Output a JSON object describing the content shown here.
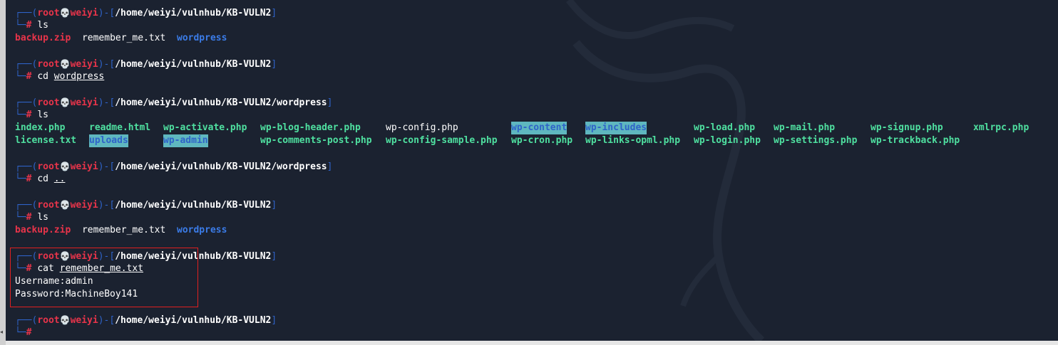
{
  "prompt": {
    "user": "root",
    "host": "weiyi",
    "skull": "💀",
    "open": "┌──(",
    "close": ")-[",
    "end": "]",
    "hash_prefix": "└─",
    "hash": "#"
  },
  "blocks": [
    {
      "path": "/home/weiyi/vulnhub/KB-VULN2",
      "cmd": "ls",
      "cmd_arg": ""
    },
    {
      "path": "/home/weiyi/vulnhub/KB-VULN2",
      "cmd": "cd",
      "cmd_arg": "wordpress"
    },
    {
      "path": "/home/weiyi/vulnhub/KB-VULN2/wordpress",
      "cmd": "ls",
      "cmd_arg": ""
    },
    {
      "path": "/home/weiyi/vulnhub/KB-VULN2/wordpress",
      "cmd": "cd",
      "cmd_arg": ".."
    },
    {
      "path": "/home/weiyi/vulnhub/KB-VULN2",
      "cmd": "ls",
      "cmd_arg": ""
    },
    {
      "path": "/home/weiyi/vulnhub/KB-VULN2",
      "cmd": "cat",
      "cmd_arg": "remember_me.txt"
    },
    {
      "path": "/home/weiyi/vulnhub/KB-VULN2",
      "cmd": "",
      "cmd_arg": ""
    }
  ],
  "ls_kb": {
    "backup": "backup.zip",
    "remember": "remember_me.txt",
    "wordpress": "wordpress"
  },
  "ls_wp": {
    "row1": [
      "index.php",
      "readme.html",
      "wp-activate.php",
      "wp-blog-header.php",
      "wp-config.php",
      "wp-content",
      "wp-includes",
      "wp-load.php",
      "wp-mail.php",
      "wp-signup.php",
      "xmlrpc.php"
    ],
    "row2": [
      "license.txt",
      "uploads",
      "wp-admin",
      "wp-comments-post.php",
      "wp-config-sample.php",
      "wp-cron.php",
      "wp-links-opml.php",
      "wp-login.php",
      "wp-settings.php",
      "wp-trackback.php"
    ]
  },
  "cat_output": {
    "username": "Username:admin",
    "password": "Password:MachineBoy141"
  },
  "colors": {
    "background": "#1b2230",
    "prompt_frame": "#2f63c8",
    "user": "#e8344a",
    "directory": "#3b7ce8",
    "executable": "#4fe0a0",
    "highlight_box": "#e02020"
  }
}
